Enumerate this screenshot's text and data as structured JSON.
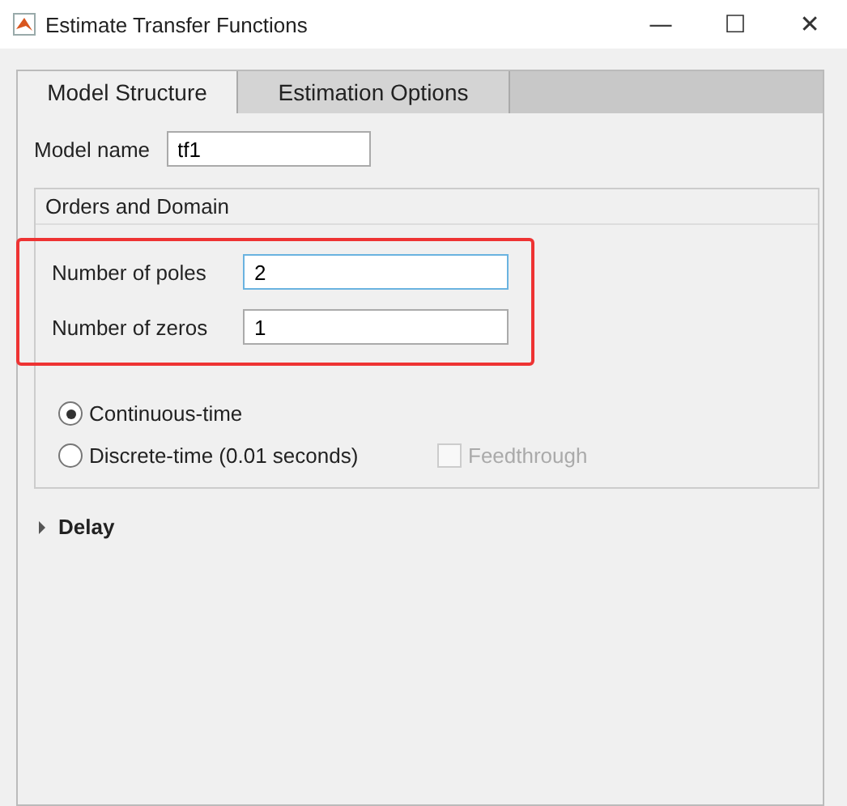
{
  "window": {
    "title": "Estimate Transfer Functions",
    "controls": [
      "—",
      "☐",
      "✕"
    ]
  },
  "tabs": [
    {
      "label": "Model Structure",
      "selected": true
    },
    {
      "label": "Estimation Options",
      "selected": false
    }
  ],
  "model_name": {
    "label": "Model name",
    "value": "tf1"
  },
  "orders_and_domain": {
    "title": "Orders and Domain",
    "fields": [
      {
        "label": "Number of poles",
        "value": "2",
        "focused": true
      },
      {
        "label": "Number of zeros",
        "value": "1",
        "focused": false
      }
    ],
    "domain": [
      {
        "label": "Continuous-time",
        "selected": true
      },
      {
        "label": "Discrete-time (0.01 seconds)",
        "selected": false
      }
    ],
    "feedthrough": {
      "label": "Feedthrough",
      "checked": false,
      "disabled": true
    }
  },
  "delay": {
    "label": "Delay",
    "expanded": false
  }
}
